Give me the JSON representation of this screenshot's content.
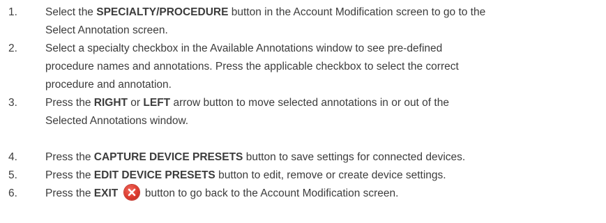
{
  "steps": [
    {
      "number": "1.",
      "lines": [
        [
          {
            "t": "Select the "
          },
          {
            "t": "SPECIALTY/PROCEDURE",
            "b": true
          },
          {
            "t": " button in the Account Modification screen to go to the"
          }
        ],
        [
          {
            "t": "Select Annotation screen."
          }
        ]
      ]
    },
    {
      "number": "2.",
      "lines": [
        [
          {
            "t": "Select a specialty checkbox in the Available Annotations window to see pre-defined"
          }
        ],
        [
          {
            "t": "procedure names and annotations. Press the applicable checkbox to select the correct"
          }
        ],
        [
          {
            "t": "procedure and annotation."
          }
        ]
      ]
    },
    {
      "number": "3.",
      "lines": [
        [
          {
            "t": "Press the "
          },
          {
            "t": "RIGHT",
            "b": true
          },
          {
            "t": " or "
          },
          {
            "t": "LEFT",
            "b": true
          },
          {
            "t": " arrow button to move selected annotations in or out of the"
          }
        ],
        [
          {
            "t": "Selected Annotations window."
          }
        ]
      ]
    },
    {
      "number": "4.",
      "lines": [
        [
          {
            "t": "Press the "
          },
          {
            "t": "CAPTURE DEVICE PRESETS",
            "b": true
          },
          {
            "t": " button to save settings for connected devices."
          }
        ]
      ]
    },
    {
      "number": "5.",
      "lines": [
        [
          {
            "t": "Press the "
          },
          {
            "t": "EDIT DEVICE PRESETS",
            "b": true
          },
          {
            "t": " button to edit, remove or create device settings."
          }
        ]
      ]
    },
    {
      "number": "6.",
      "lines": [
        [
          {
            "t": "Press the "
          },
          {
            "t": "EXIT",
            "b": true
          },
          {
            "t": " "
          },
          {
            "icon": "exit-x-icon"
          },
          {
            "t": " button to go back to the Account Modification screen."
          }
        ]
      ]
    }
  ],
  "colors": {
    "text": "#3c3c3c",
    "exit_icon": "#dd3b2e"
  }
}
